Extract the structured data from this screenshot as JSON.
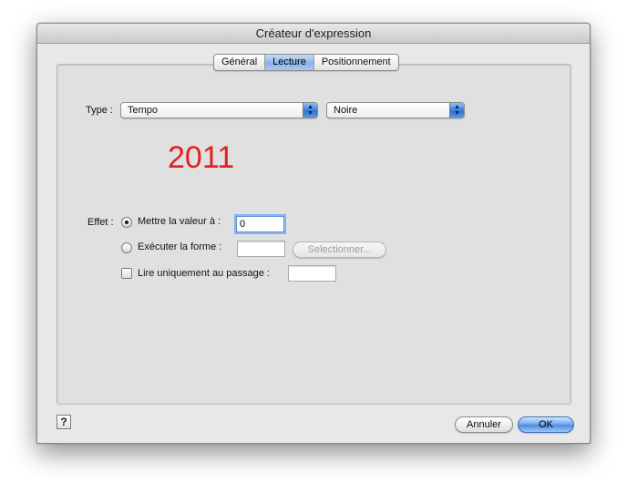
{
  "window": {
    "title": "Créateur d'expression"
  },
  "tabs": [
    {
      "label": "Général",
      "active": false
    },
    {
      "label": "Lecture",
      "active": true
    },
    {
      "label": "Positionnement",
      "active": false
    }
  ],
  "type_row": {
    "label": "Type :",
    "type_value": "Tempo",
    "note_value": "Noire"
  },
  "year_text": "2011",
  "effect": {
    "label": "Effet :",
    "set_value_label": "Mettre la valeur à :",
    "set_value": "0",
    "run_shape_label": "Exécuter la forme :",
    "run_shape_value": "",
    "select_button": "Selectionner...",
    "read_only_label": "Lire uniquement au passage :",
    "read_only_value": ""
  },
  "buttons": {
    "help": "?",
    "cancel": "Annuler",
    "ok": "OK"
  },
  "colors": {
    "year": "#e02020",
    "accent": "#4a8be0"
  }
}
